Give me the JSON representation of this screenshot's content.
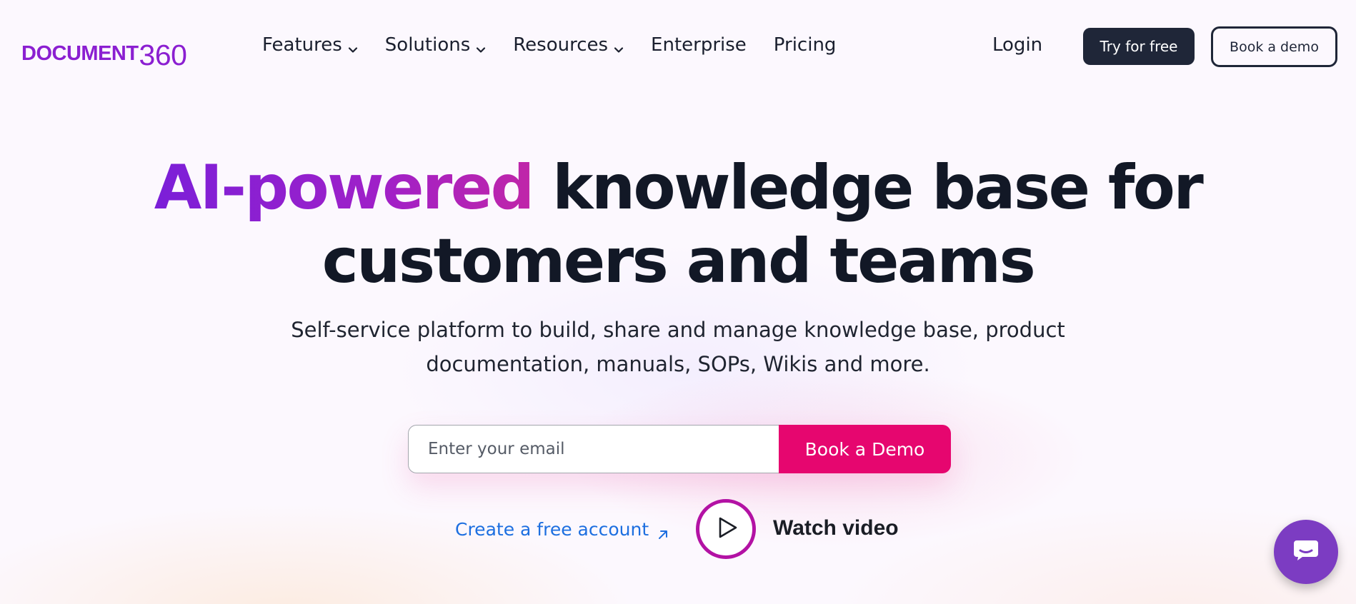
{
  "logo": {
    "word": "DOCUMENT",
    "number": "360"
  },
  "nav": {
    "items": [
      {
        "label": "Features",
        "has_dropdown": true
      },
      {
        "label": "Solutions",
        "has_dropdown": true
      },
      {
        "label": "Resources",
        "has_dropdown": true
      },
      {
        "label": "Enterprise",
        "has_dropdown": false
      },
      {
        "label": "Pricing",
        "has_dropdown": false
      }
    ],
    "login_label": "Login",
    "try_label": "Try for free",
    "demo_label": "Book a demo"
  },
  "hero": {
    "headline_accent": "AI-powered",
    "headline_line1_rest": " knowledge base for",
    "headline_line2": "customers and teams",
    "subtitle_line1": "Self-service platform to build, share and manage knowledge base, product",
    "subtitle_line2": "documentation, manuals, SOPs, Wikis and more.",
    "email_placeholder": "Enter your email",
    "book_demo_label": "Book a Demo",
    "create_account_label": "Create a free account",
    "watch_video_label": "Watch video"
  },
  "icons": {
    "dropdown": "chevron-down-icon",
    "external": "arrow-up-right-icon",
    "play": "play-icon",
    "chat": "chat-icon"
  },
  "colors": {
    "brand_purple": "#8b1fd1",
    "accent_pink": "#e6066f",
    "dark_button": "#1f2638",
    "link_blue": "#1d6fe0",
    "chat_purple": "#7c3cc2"
  }
}
